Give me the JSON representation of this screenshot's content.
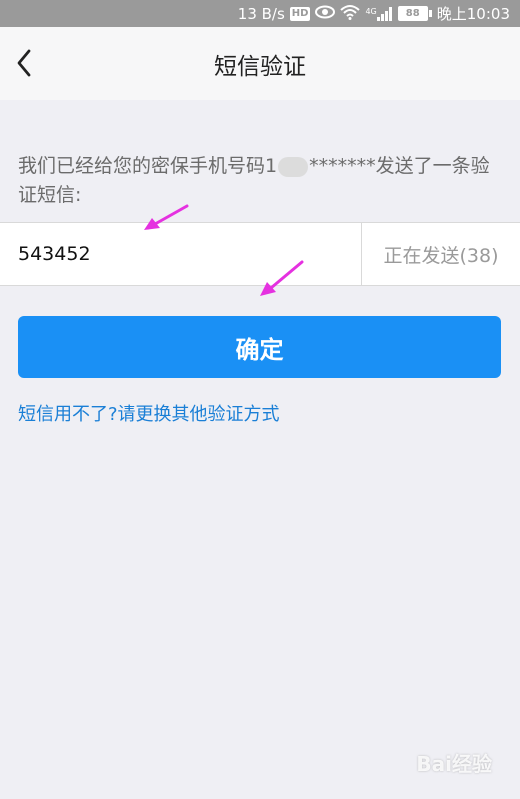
{
  "status_bar": {
    "speed": "13 B/s",
    "hd": "HD",
    "signal": "4G",
    "battery": "88",
    "time": "晚上10:03"
  },
  "nav": {
    "title": "短信验证"
  },
  "info": {
    "prefix": "我们已经给您的密保手机号码1",
    "masked": "*******",
    "suffix": "发送了一条验证短信:"
  },
  "code": {
    "value": "543452",
    "send_status": "正在发送(38)"
  },
  "confirm": {
    "label": "确定"
  },
  "alt_link": "短信用不了?请更换其他验证方式",
  "watermark": "Bai经验",
  "colors": {
    "primary": "#1a90f5",
    "link": "#1a7fd6",
    "annotation_arrow": "#e531e0"
  }
}
